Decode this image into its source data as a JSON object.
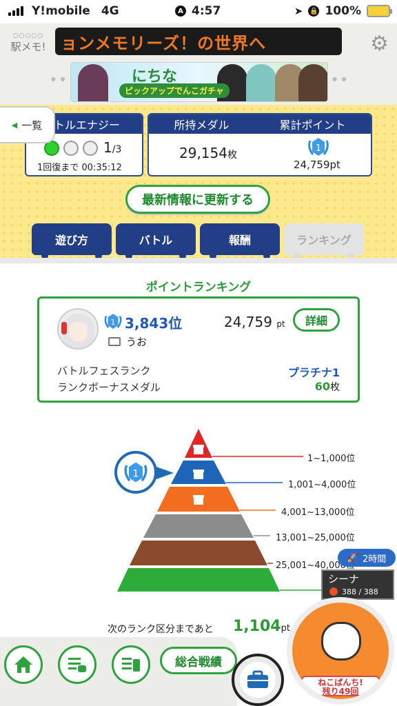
{
  "status_bar": {
    "carrier": "Y!mobile",
    "network": "4G",
    "time": "4:57",
    "battery": "100%"
  },
  "header": {
    "logo_text": "駅メモ!",
    "ticker_text": "ョンメモリーズ！の世界へ",
    "banner": {
      "title": "にちな",
      "subtitle": "ピックアップでんこガチャ"
    }
  },
  "ichiran_label": "一覧",
  "energy_card": {
    "title": "トルエナジー",
    "count": "1",
    "max": "/3",
    "recover_text": "1回復まで 00:35:12",
    "filled": 1,
    "total": 3
  },
  "medal_card": {
    "medal_title": "所持メダル",
    "points_title": "累計ポイント",
    "medal_value": "29,154",
    "medal_unit": "枚",
    "rank_badge": "1",
    "points_value": "24,759pt"
  },
  "refresh_button": "最新情報に更新する",
  "tabs": [
    {
      "label": "遊び方",
      "active": true
    },
    {
      "label": "バトル",
      "active": true
    },
    {
      "label": "報酬",
      "active": true
    },
    {
      "label": "ランキング",
      "active": false
    }
  ],
  "ranking": {
    "title": "ポイントランキング",
    "badge": "1",
    "position": "3,843位",
    "username": "うお",
    "points": "24,759",
    "points_unit": "pt",
    "detail_button": "詳細",
    "rows": [
      {
        "label": "バトルフェスランク",
        "value": "プラチナ1",
        "unit": ""
      },
      {
        "label": "ランクボーナスメダル",
        "value": "60",
        "unit": "枚"
      }
    ]
  },
  "pyramid": {
    "tiers": [
      {
        "range": "1~1,000位",
        "color": "#e02626"
      },
      {
        "range": "1,001~4,000位",
        "color": "#1f64b8"
      },
      {
        "range": "4,001~13,000位",
        "color": "#f26d1f"
      },
      {
        "range": "13,001~25,000位",
        "color": "#8c8c8c"
      },
      {
        "range": "25,001~40,000位",
        "color": "#8b4a2b"
      },
      {
        "range": "",
        "color": "#2eac3a"
      }
    ],
    "current_tier_badge": "1"
  },
  "next_rank": {
    "label": "次のランク区分まであと",
    "value": "1,104",
    "unit": "pt"
  },
  "character": {
    "time_pill": "2時間",
    "name": "シーナ",
    "hp": "388 / 388"
  },
  "neko": {
    "line1": "ねこぱんち!",
    "line2": "残り49回"
  },
  "bottom_nav": {
    "stats_button": "総合戦績"
  },
  "colors": {
    "navy": "#213e86",
    "green": "#2ea23c",
    "yellow": "#fde98d"
  }
}
